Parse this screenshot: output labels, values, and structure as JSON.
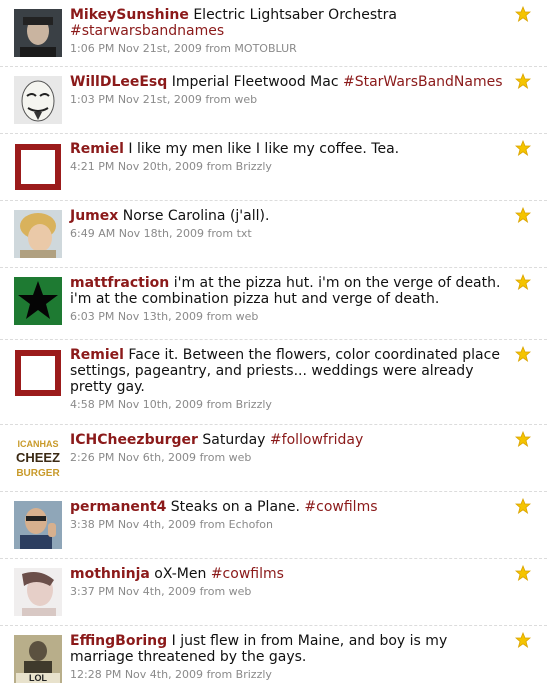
{
  "tweets": [
    {
      "user": "MikeySunshine",
      "text": "Electric Lightsaber Orchestra",
      "tag": "#starwarsbandnames",
      "time": "1:06 PM Nov 21st, 2009",
      "via": "MOTOBLUR",
      "avatar": "dark-portrait-icon"
    },
    {
      "user": "WillDLeeEsq",
      "text": "Imperial Fleetwood Mac",
      "tag": "#StarWarsBandNames",
      "time": "1:03 PM Nov 21st, 2009",
      "via": "web",
      "avatar": "mask-icon"
    },
    {
      "user": "Remiel",
      "text": "I like my men like I like my coffee. Tea.",
      "tag": "",
      "time": "4:21 PM Nov 20th, 2009",
      "via": "Brizzly",
      "avatar": "red-square-icon"
    },
    {
      "user": "Jumex",
      "text": "Norse Carolina (j'all).",
      "tag": "",
      "time": "6:49 AM Nov 18th, 2009",
      "via": "txt",
      "avatar": "blond-portrait-icon"
    },
    {
      "user": "mattfraction",
      "text": "i'm at the pizza hut. i'm on the verge of death. i'm at the combination pizza hut and verge of death.",
      "tag": "",
      "time": "6:03 PM Nov 13th, 2009",
      "via": "web",
      "avatar": "black-star-icon"
    },
    {
      "user": "Remiel",
      "text": "Face it. Between the flowers, color coordinated place settings, pageantry, and priests... weddings were already pretty gay.",
      "tag": "",
      "time": "4:58 PM Nov 10th, 2009",
      "via": "Brizzly",
      "avatar": "red-square-icon"
    },
    {
      "user": "ICHCheezburger",
      "text": "Saturday",
      "tag": "#followfriday",
      "time": "2:26 PM Nov 6th, 2009",
      "via": "web",
      "avatar": "cheezburger-logo-icon"
    },
    {
      "user": "permanent4",
      "text": "Steaks on a Plane.",
      "tag": "#cowfilms",
      "time": "3:38 PM Nov 4th, 2009",
      "via": "Echofon",
      "avatar": "thumbs-up-portrait-icon"
    },
    {
      "user": "mothninja",
      "text": "oX-Men",
      "tag": "#cowfilms",
      "time": "3:37 PM Nov 4th, 2009",
      "via": "web",
      "avatar": "pale-portrait-icon"
    },
    {
      "user": "EffingBoring",
      "text": "I just flew in from Maine, and boy is my marriage threatened by the gays.",
      "tag": "",
      "time": "12:28 PM Nov 4th, 2009",
      "via": "Brizzly",
      "avatar": "lol-desk-icon"
    }
  ],
  "labels": {
    "from": "from"
  },
  "avatar_text": {
    "cheez_line1": "ICANHAS",
    "cheez_line2": "CHEEZ",
    "cheez_line3": "BURGER",
    "lol": "LOL"
  },
  "colors": {
    "username": "#8b1a1a",
    "hashtag": "#8b1a1a",
    "meta": "#8a8a8a",
    "star": "#f5c400",
    "divider": "#dcdcdc"
  }
}
